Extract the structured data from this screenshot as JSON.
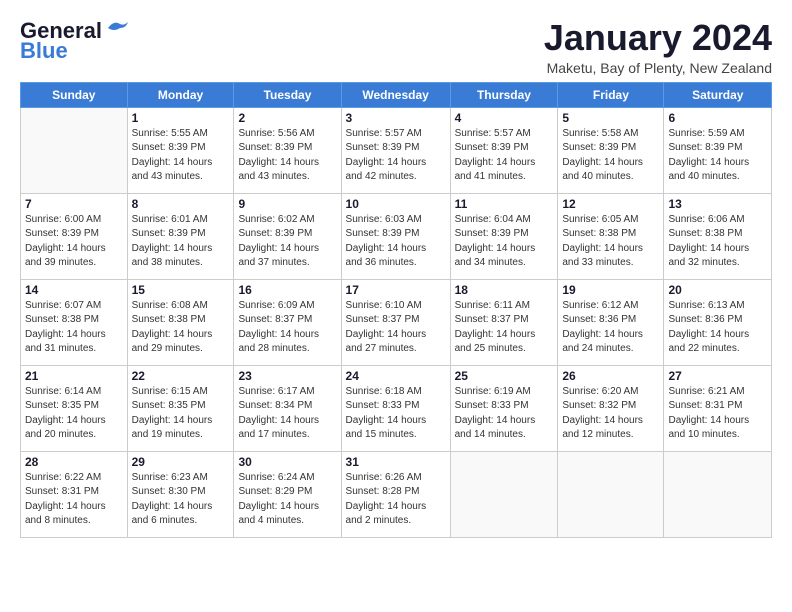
{
  "logo": {
    "line1": "General",
    "line2": "Blue"
  },
  "title": "January 2024",
  "subtitle": "Maketu, Bay of Plenty, New Zealand",
  "days_of_week": [
    "Sunday",
    "Monday",
    "Tuesday",
    "Wednesday",
    "Thursday",
    "Friday",
    "Saturday"
  ],
  "weeks": [
    [
      {
        "num": "",
        "info": ""
      },
      {
        "num": "1",
        "info": "Sunrise: 5:55 AM\nSunset: 8:39 PM\nDaylight: 14 hours\nand 43 minutes."
      },
      {
        "num": "2",
        "info": "Sunrise: 5:56 AM\nSunset: 8:39 PM\nDaylight: 14 hours\nand 43 minutes."
      },
      {
        "num": "3",
        "info": "Sunrise: 5:57 AM\nSunset: 8:39 PM\nDaylight: 14 hours\nand 42 minutes."
      },
      {
        "num": "4",
        "info": "Sunrise: 5:57 AM\nSunset: 8:39 PM\nDaylight: 14 hours\nand 41 minutes."
      },
      {
        "num": "5",
        "info": "Sunrise: 5:58 AM\nSunset: 8:39 PM\nDaylight: 14 hours\nand 40 minutes."
      },
      {
        "num": "6",
        "info": "Sunrise: 5:59 AM\nSunset: 8:39 PM\nDaylight: 14 hours\nand 40 minutes."
      }
    ],
    [
      {
        "num": "7",
        "info": "Sunrise: 6:00 AM\nSunset: 8:39 PM\nDaylight: 14 hours\nand 39 minutes."
      },
      {
        "num": "8",
        "info": "Sunrise: 6:01 AM\nSunset: 8:39 PM\nDaylight: 14 hours\nand 38 minutes."
      },
      {
        "num": "9",
        "info": "Sunrise: 6:02 AM\nSunset: 8:39 PM\nDaylight: 14 hours\nand 37 minutes."
      },
      {
        "num": "10",
        "info": "Sunrise: 6:03 AM\nSunset: 8:39 PM\nDaylight: 14 hours\nand 36 minutes."
      },
      {
        "num": "11",
        "info": "Sunrise: 6:04 AM\nSunset: 8:39 PM\nDaylight: 14 hours\nand 34 minutes."
      },
      {
        "num": "12",
        "info": "Sunrise: 6:05 AM\nSunset: 8:38 PM\nDaylight: 14 hours\nand 33 minutes."
      },
      {
        "num": "13",
        "info": "Sunrise: 6:06 AM\nSunset: 8:38 PM\nDaylight: 14 hours\nand 32 minutes."
      }
    ],
    [
      {
        "num": "14",
        "info": "Sunrise: 6:07 AM\nSunset: 8:38 PM\nDaylight: 14 hours\nand 31 minutes."
      },
      {
        "num": "15",
        "info": "Sunrise: 6:08 AM\nSunset: 8:38 PM\nDaylight: 14 hours\nand 29 minutes."
      },
      {
        "num": "16",
        "info": "Sunrise: 6:09 AM\nSunset: 8:37 PM\nDaylight: 14 hours\nand 28 minutes."
      },
      {
        "num": "17",
        "info": "Sunrise: 6:10 AM\nSunset: 8:37 PM\nDaylight: 14 hours\nand 27 minutes."
      },
      {
        "num": "18",
        "info": "Sunrise: 6:11 AM\nSunset: 8:37 PM\nDaylight: 14 hours\nand 25 minutes."
      },
      {
        "num": "19",
        "info": "Sunrise: 6:12 AM\nSunset: 8:36 PM\nDaylight: 14 hours\nand 24 minutes."
      },
      {
        "num": "20",
        "info": "Sunrise: 6:13 AM\nSunset: 8:36 PM\nDaylight: 14 hours\nand 22 minutes."
      }
    ],
    [
      {
        "num": "21",
        "info": "Sunrise: 6:14 AM\nSunset: 8:35 PM\nDaylight: 14 hours\nand 20 minutes."
      },
      {
        "num": "22",
        "info": "Sunrise: 6:15 AM\nSunset: 8:35 PM\nDaylight: 14 hours\nand 19 minutes."
      },
      {
        "num": "23",
        "info": "Sunrise: 6:17 AM\nSunset: 8:34 PM\nDaylight: 14 hours\nand 17 minutes."
      },
      {
        "num": "24",
        "info": "Sunrise: 6:18 AM\nSunset: 8:33 PM\nDaylight: 14 hours\nand 15 minutes."
      },
      {
        "num": "25",
        "info": "Sunrise: 6:19 AM\nSunset: 8:33 PM\nDaylight: 14 hours\nand 14 minutes."
      },
      {
        "num": "26",
        "info": "Sunrise: 6:20 AM\nSunset: 8:32 PM\nDaylight: 14 hours\nand 12 minutes."
      },
      {
        "num": "27",
        "info": "Sunrise: 6:21 AM\nSunset: 8:31 PM\nDaylight: 14 hours\nand 10 minutes."
      }
    ],
    [
      {
        "num": "28",
        "info": "Sunrise: 6:22 AM\nSunset: 8:31 PM\nDaylight: 14 hours\nand 8 minutes."
      },
      {
        "num": "29",
        "info": "Sunrise: 6:23 AM\nSunset: 8:30 PM\nDaylight: 14 hours\nand 6 minutes."
      },
      {
        "num": "30",
        "info": "Sunrise: 6:24 AM\nSunset: 8:29 PM\nDaylight: 14 hours\nand 4 minutes."
      },
      {
        "num": "31",
        "info": "Sunrise: 6:26 AM\nSunset: 8:28 PM\nDaylight: 14 hours\nand 2 minutes."
      },
      {
        "num": "",
        "info": ""
      },
      {
        "num": "",
        "info": ""
      },
      {
        "num": "",
        "info": ""
      }
    ]
  ]
}
